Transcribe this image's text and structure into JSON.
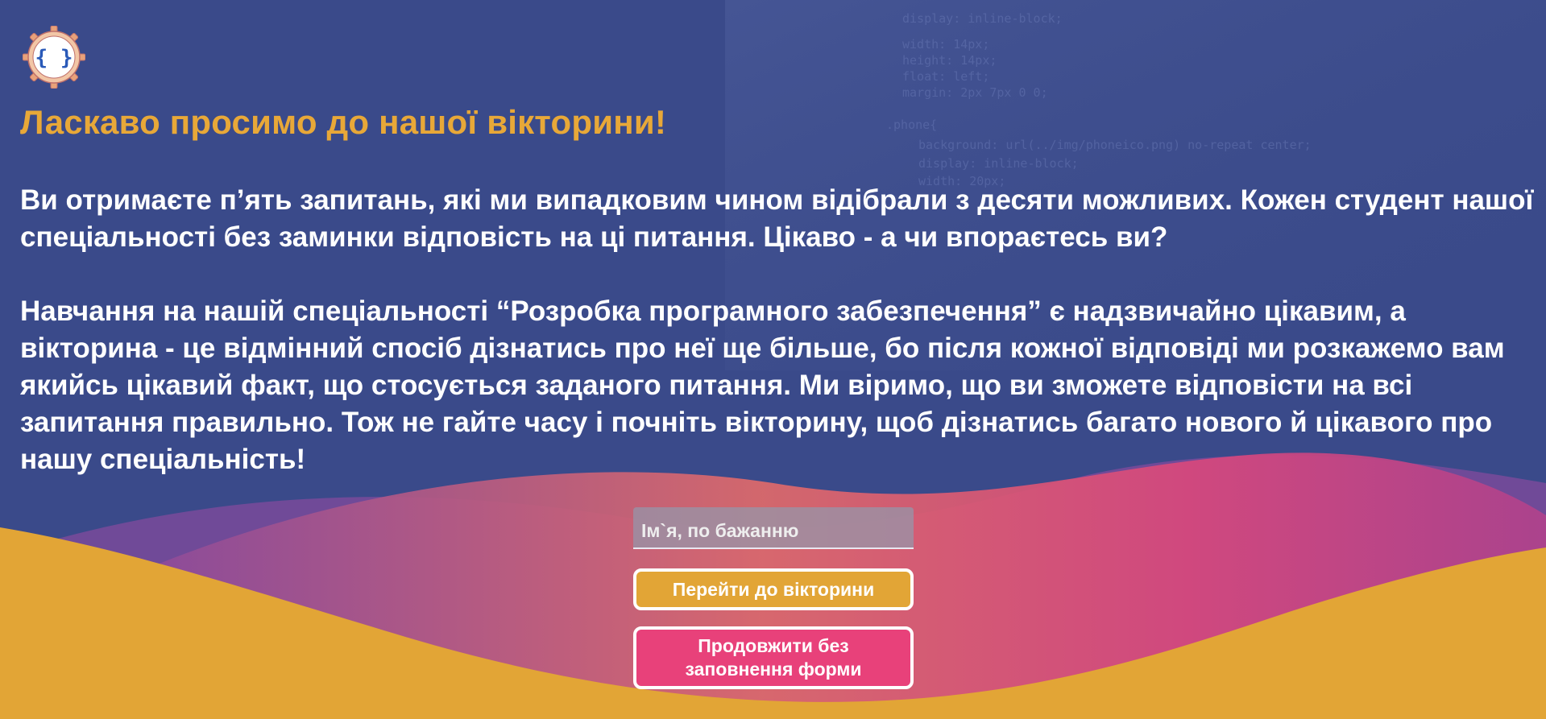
{
  "logo": {
    "icon": "curly-braces-gear-logo",
    "symbol": "{ }"
  },
  "welcome": {
    "title": "Ласкаво просимо до нашої вікторини!",
    "paragraph1": "Ви отримаєте п’ять запитань, які ми випадковим чином відібрали з десяти можливих. Кожен студент нашої спеціальності без заминки відповість на ці питання. Цікаво - а чи впораєтесь ви?",
    "paragraph2": "Навчання на нашій спеціальності “Розробка програмного забезпечення” є надзвичайно цікавим, а вікторина - це відмінний спосіб дізнатись про неї ще більше, бо після кожної відповіді ми розкажемо вам якийсь цікавий факт, що стосується заданого питання. Ми віримо, що ви зможете відповісти на всі запитання правильно. Тож не гайте часу і почніть вікторину, щоб дізнатись багато нового й цікавого про нашу спеціальність!"
  },
  "form": {
    "name_placeholder": "Ім`я, по бажанню",
    "name_value": "",
    "go_button": "Перейти до вікторини",
    "skip_button_line1": "Продовжити без",
    "skip_button_line2": "заповнення форми"
  },
  "colors": {
    "background": "#3a4a8a",
    "title": "#e8a838",
    "go_button": "#e2a536",
    "skip_button": "#e8417a",
    "wave_yellow": "#e2a536",
    "wave_pink": "#d94a8c",
    "wave_purple": "#7a4a9a"
  }
}
